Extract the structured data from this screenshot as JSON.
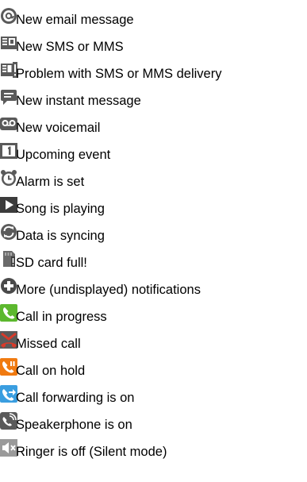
{
  "notifications": [
    {
      "icon": "email-icon",
      "label": "New email message"
    },
    {
      "icon": "sms-icon",
      "label": "New SMS or MMS"
    },
    {
      "icon": "sms-error-icon",
      "label": "Problem with SMS or MMS delivery"
    },
    {
      "icon": "chat-bubble-icon",
      "label": "New instant message"
    },
    {
      "icon": "voicemail-icon",
      "label": "New voicemail"
    },
    {
      "icon": "calendar-icon",
      "label": "Upcoming event"
    },
    {
      "icon": "alarm-clock-icon",
      "label": "Alarm is set"
    },
    {
      "icon": "play-icon",
      "label": "Song is playing"
    },
    {
      "icon": "sync-icon",
      "label": "Data is syncing"
    },
    {
      "icon": "sd-card-full-icon",
      "label": "SD card full!"
    },
    {
      "icon": "plus-icon",
      "label": "More (undisplayed) notifications"
    },
    {
      "icon": "phone-call-icon",
      "label": "Call in progress"
    },
    {
      "icon": "missed-call-icon",
      "label": "Missed call"
    },
    {
      "icon": "call-hold-icon",
      "label": "Call on hold"
    },
    {
      "icon": "call-forward-icon",
      "label": "Call forwarding is on"
    },
    {
      "icon": "speakerphone-icon",
      "label": "Speakerphone is on"
    },
    {
      "icon": "ringer-off-icon",
      "label": "Ringer is off (Silent mode)"
    }
  ],
  "colors": {
    "icon_gray": "#5a5a5a",
    "call_green": "#5cb82e",
    "missed_red": "#d83a2a",
    "hold_orange": "#f07a10",
    "forward_blue": "#3a9ee0"
  }
}
